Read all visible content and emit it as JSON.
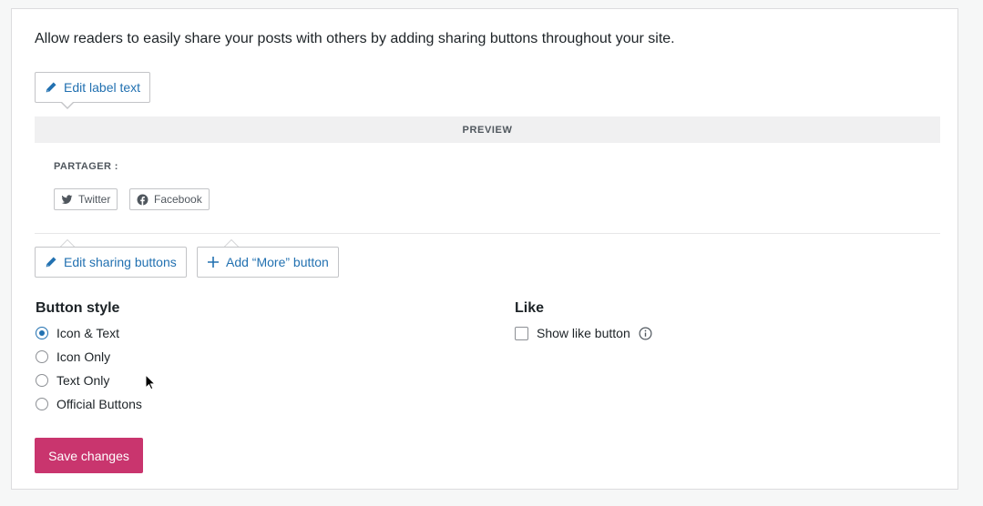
{
  "intro": "Allow readers to easily share your posts with others by adding sharing buttons throughout your site.",
  "edit_label_button": {
    "label": "Edit label text",
    "icon": "pencil-icon"
  },
  "preview": {
    "title": "PREVIEW",
    "share_label": "PARTAGER :",
    "buttons": [
      {
        "label": "Twitter",
        "icon": "twitter-icon"
      },
      {
        "label": "Facebook",
        "icon": "facebook-icon"
      }
    ]
  },
  "edit_sharing_button": {
    "label": "Edit sharing buttons",
    "icon": "pencil-icon"
  },
  "add_more_button": {
    "label": "Add “More” button",
    "icon": "plus-icon"
  },
  "button_style": {
    "heading": "Button style",
    "selected": "Icon & Text",
    "options": [
      "Icon & Text",
      "Icon Only",
      "Text Only",
      "Official Buttons"
    ]
  },
  "like": {
    "heading": "Like",
    "checkbox_label": "Show like button",
    "checked": false,
    "info_icon": "info-icon"
  },
  "save_button": "Save changes",
  "colors": {
    "accent": "#2271b1",
    "save": "#c9356e"
  }
}
